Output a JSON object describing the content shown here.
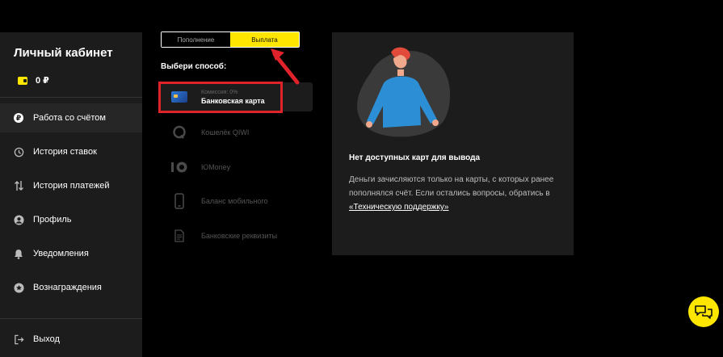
{
  "sidebar": {
    "title": "Личный кабинет",
    "balance": "0 ₽",
    "items": [
      {
        "label": "Работа со счётом",
        "icon": "ruble-circle-icon",
        "active": true
      },
      {
        "label": "История ставок",
        "icon": "history-icon"
      },
      {
        "label": "История платежей",
        "icon": "transfer-arrows-icon"
      },
      {
        "label": "Профиль",
        "icon": "user-icon"
      },
      {
        "label": "Уведомления",
        "icon": "bell-icon"
      },
      {
        "label": "Вознаграждения",
        "icon": "star-badge-icon"
      }
    ],
    "logout": "Выход"
  },
  "tabs": {
    "deposit": "Пополнение",
    "withdraw": "Выплата",
    "active": "withdraw"
  },
  "methods": {
    "heading": "Выбери способ:",
    "items": [
      {
        "label": "Банковская карта",
        "note": "Комиссия: 0%",
        "icon": "bank-card-icon",
        "selected": true
      },
      {
        "label": "Кошелёк QIWI",
        "icon": "qiwi-icon"
      },
      {
        "label": "ЮMoney",
        "icon": "yumoney-icon"
      },
      {
        "label": "Баланс мобильного",
        "icon": "mobile-phone-icon"
      },
      {
        "label": "Банковские реквизиты",
        "icon": "document-icon"
      }
    ]
  },
  "panel": {
    "title": "Нет доступных карт для вывода",
    "description": "Деньги зачисляются только на карты, с которых ранее пополнялся счёт. Если остались вопросы, обратись в ",
    "link": "«Техническую поддержку»"
  },
  "colors": {
    "accent": "#ffe600",
    "background": "#000000",
    "panel": "#1c1c1c",
    "highlight": "#e0222a"
  }
}
